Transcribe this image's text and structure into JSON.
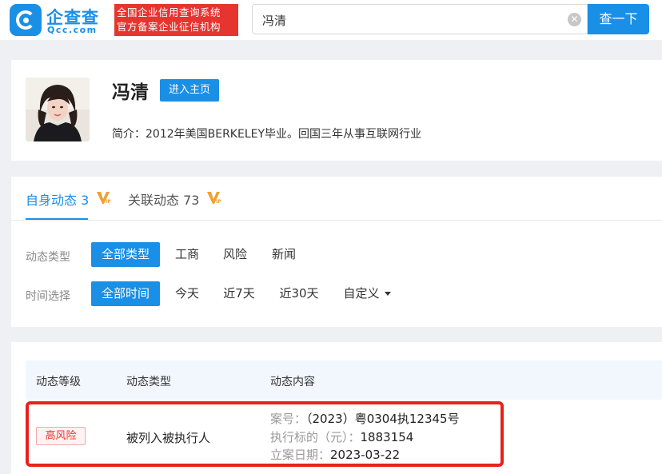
{
  "header": {
    "logo_cn": "企查查",
    "logo_en": "Qcc.com",
    "slogan_line1": "全国企业信用查询系统",
    "slogan_line2": "官方备案企业征信机构",
    "search_value": "冯清",
    "search_button": "查一下",
    "brand_color": "#1a8fe6",
    "slogan_bg": "#e6342f"
  },
  "profile": {
    "name": "冯清",
    "home_button": "进入主页",
    "intro_label": "简介：",
    "intro_text": "2012年美国BERKELEY毕业。回国三年从事互联网行业"
  },
  "tabs": [
    {
      "label": "自身动态",
      "count": "3",
      "active": true,
      "vip": true
    },
    {
      "label": "关联动态",
      "count": "73",
      "active": false,
      "vip": true
    }
  ],
  "filters": {
    "type_label": "动态类型",
    "type_options": [
      "全部类型",
      "工商",
      "风险",
      "新闻"
    ],
    "type_selected": "全部类型",
    "time_label": "时间选择",
    "time_options": [
      "全部时间",
      "今天",
      "近7天",
      "近30天",
      "自定义"
    ],
    "time_selected": "全部时间"
  },
  "table": {
    "headers": [
      "动态等级",
      "动态类型",
      "动态内容"
    ],
    "rows": [
      {
        "level": "高风险",
        "type": "被列入被执行人",
        "details": [
          {
            "key": "案号：",
            "value": "（2023）粤0304执12345号"
          },
          {
            "key": "执行标的（元）：",
            "value": "1883154"
          },
          {
            "key": "立案日期：",
            "value": "2023-03-22"
          }
        ]
      }
    ]
  },
  "colors": {
    "accent": "#1a8fe6",
    "risk": "#e6342f",
    "highlight": "#e8211d",
    "vip": "#f0a030"
  }
}
